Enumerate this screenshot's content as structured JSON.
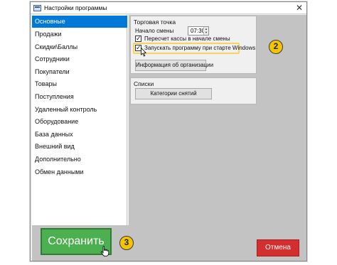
{
  "window": {
    "title": "Настройки программы",
    "close_glyph": "✕"
  },
  "sidebar": {
    "items": [
      {
        "label": "Основные",
        "active": true
      },
      {
        "label": "Продажи"
      },
      {
        "label": "Скидки\\Баллы"
      },
      {
        "label": "Сотрудники"
      },
      {
        "label": "Покупатели"
      },
      {
        "label": "Товары"
      },
      {
        "label": "Поступления"
      },
      {
        "label": "Удаленный контроль"
      },
      {
        "label": "Оборудование"
      },
      {
        "label": "База данных"
      },
      {
        "label": "Внешний вид"
      },
      {
        "label": "Дополнительно"
      },
      {
        "label": "Обмен данными"
      }
    ]
  },
  "trading_point": {
    "title": "Торговая точка",
    "shift_start_label": "Начало смены",
    "shift_start_value": "07:30",
    "recount_label": "Пересчет кассы в начале смены",
    "recount_checked": true,
    "autostart_label": "Запускать программу при старте Windows",
    "autostart_checked": true,
    "org_info_button": "Информация об организации"
  },
  "lists": {
    "title": "Списки",
    "withdrawal_categories_button": "Категории снятий"
  },
  "annotations": {
    "step2": "2",
    "step3": "3"
  },
  "footer": {
    "save_label": "Сохранить",
    "cancel_label": "Отмена"
  },
  "colors": {
    "accent": "#0078d7",
    "save": "#4caf50",
    "cancel": "#d32f2f",
    "badge": "#f4c400",
    "highlight": "#f6d45e"
  },
  "icons": [
    "app-icon",
    "close-icon",
    "checkmark-icon",
    "cursor-arrow-icon",
    "hand-pointer-icon"
  ]
}
